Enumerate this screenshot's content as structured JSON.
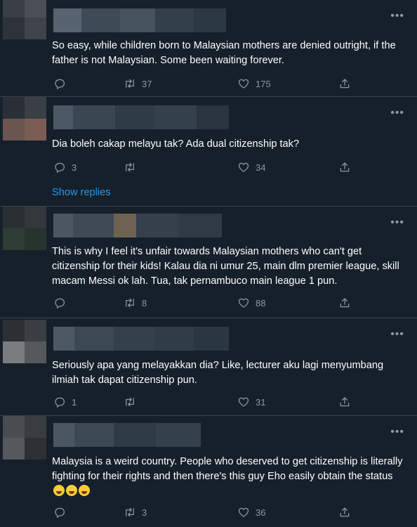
{
  "colors": {
    "background": "#15202b",
    "text": "#ffffff",
    "muted": "#8b98a5",
    "link": "#1d9bf0",
    "divider": "#38444d"
  },
  "more_label": "•••",
  "tweets": [
    {
      "text": "So easy, while children born to Malaysian mothers are denied outright, if the father is not Malaysian. Some been waiting forever.",
      "replies": "",
      "retweets": "37",
      "likes": "175"
    },
    {
      "text": "Dia boleh cakap melayu tak? Ada dual citizenship tak?",
      "replies": "3",
      "retweets": "",
      "likes": "34",
      "show_replies": "Show replies"
    },
    {
      "text": "This is why I feel it's unfair towards Malaysian mothers who can't get citizenship for their kids! Kalau dia ni umur 25, main dlm premier league, skill macam Messi ok lah. Tua, tak pernambuco main league 1 pun.",
      "replies": "",
      "retweets": "8",
      "likes": "88"
    },
    {
      "text": "Seriously apa yang melayakkan dia? Like, lecturer aku lagi menyumbang ilmiah tak dapat citizenship pun.",
      "replies": "1",
      "retweets": "",
      "likes": "31"
    },
    {
      "text": "Malaysia is a weird country. People who deserved to get citizenship is literally fighting for their rights and then there's this guy Eho easily obtain the status",
      "emoji_names": [
        "joy-emoji",
        "joy-emoji",
        "joy-emoji"
      ],
      "replies": "",
      "retweets": "3",
      "likes": "36"
    }
  ]
}
